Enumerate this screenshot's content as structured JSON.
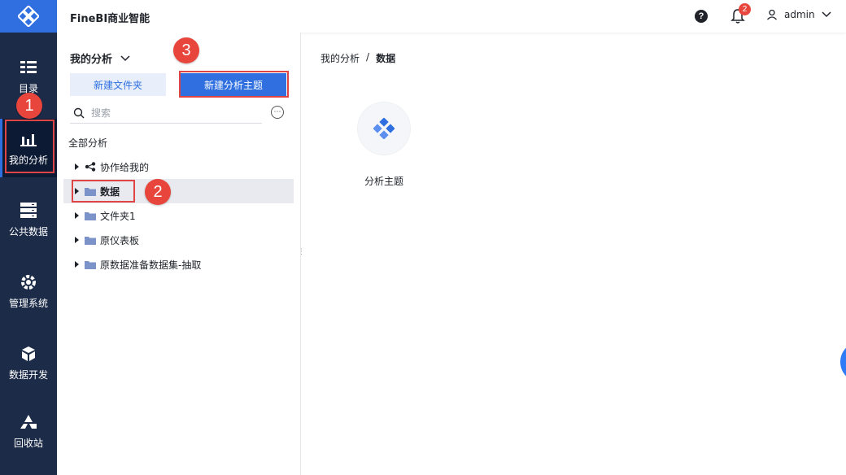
{
  "app": {
    "title": "FineBI商业智能"
  },
  "leftnav": {
    "items": [
      {
        "label": "目录",
        "icon": "list-icon"
      },
      {
        "label": "我的分析",
        "icon": "chart-icon"
      },
      {
        "label": "公共数据",
        "icon": "database-icon"
      },
      {
        "label": "管理系统",
        "icon": "gear-icon"
      },
      {
        "label": "数据开发",
        "icon": "cube-icon"
      },
      {
        "label": "回收站",
        "icon": "recycle-icon"
      }
    ]
  },
  "header": {
    "notification_count": "2",
    "user": "admin",
    "help": "?"
  },
  "panel": {
    "title": "我的分析",
    "new_folder": "新建文件夹",
    "new_topic": "新建分析主题",
    "search_placeholder": "搜索",
    "all_label": "全部分析",
    "tree": [
      {
        "label": "协作给我的",
        "icon": "share-icon"
      },
      {
        "label": "数据",
        "icon": "folder-icon",
        "selected": true
      },
      {
        "label": "文件夹1",
        "icon": "folder-icon"
      },
      {
        "label": "原仪表板",
        "icon": "folder-icon"
      },
      {
        "label": "原数据准备数据集-抽取",
        "icon": "folder-icon"
      }
    ]
  },
  "breadcrumb": {
    "root": "我的分析",
    "sep": "/",
    "current": "数据"
  },
  "content": {
    "topic_label": "分析主题"
  },
  "annotations": {
    "step1": "1",
    "step2": "2",
    "step3": "3"
  },
  "colors": {
    "nav_bg": "#1c2b48",
    "accent": "#2f6fe0",
    "annotation_red": "#e8453c"
  }
}
